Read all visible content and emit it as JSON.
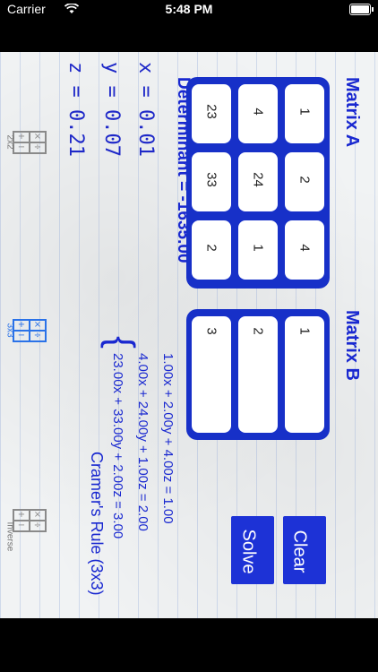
{
  "status_bar": {
    "carrier": "Carrier",
    "time": "5:48 PM"
  },
  "tabs": [
    {
      "label": "2x2",
      "icon": "matrix-ops-icon",
      "active": false
    },
    {
      "label": "3x3",
      "icon": "matrix-ops-icon",
      "active": true
    },
    {
      "label": "Inverse",
      "icon": "matrix-ops-icon",
      "active": false
    }
  ],
  "icon_glyphs": {
    "plus": "+",
    "minus": "−",
    "times": "×",
    "divide": "÷"
  },
  "matrix_a": {
    "title": "Matrix A",
    "rows": [
      [
        "1",
        "2",
        "4"
      ],
      [
        "4",
        "24",
        "1"
      ],
      [
        "23",
        "33",
        "2"
      ]
    ]
  },
  "matrix_b": {
    "title": "Matrix B",
    "values": [
      "1",
      "2",
      "3"
    ]
  },
  "results": {
    "determinant": "Determinant = -1635.00",
    "x": "x = 0.01",
    "y": "y = 0.07",
    "z": "z = 0.21"
  },
  "equations": [
    "1.00x + 2.00y + 4.00z = 1.00",
    "4.00x + 24.00y + 1.00z = 2.00",
    "23.00x + 33.00y + 2.00z = 3.00"
  ],
  "buttons": {
    "clear": "Clear",
    "solve": "Solve"
  },
  "footer_title": "Cramer's Rule (3x3)",
  "colors": {
    "accent": "#1730c8",
    "tab_active": "#2a72e8"
  }
}
